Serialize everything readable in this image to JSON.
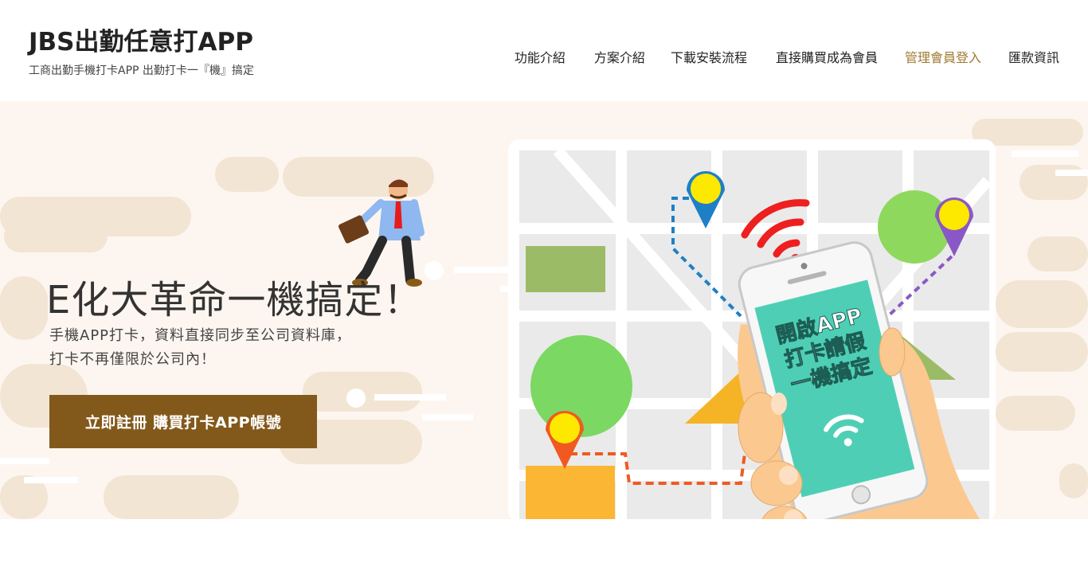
{
  "header": {
    "title": "JBS出勤任意打APP",
    "tagline": "工商出勤手機打卡APP  出勤打卡一『機』搞定"
  },
  "nav": {
    "items": [
      {
        "label": "功能介紹"
      },
      {
        "label": "方案介紹"
      },
      {
        "label": "下載安裝流程"
      },
      {
        "label": "直接購買成為會員"
      },
      {
        "label": "管理會員登入"
      },
      {
        "label": "匯款資訊"
      }
    ],
    "active_index": 4
  },
  "hero": {
    "title": "E化大革命一機搞定！",
    "subtitle_line1": "手機APP打卡，資料直接同步至公司資料庫，",
    "subtitle_line2": "打卡不再僅限於公司內！",
    "cta_label": "立即註冊 購買打卡APP帳號",
    "phone_line1": "開啟APP",
    "phone_line2": "打卡請假",
    "phone_line3": "一機搞定"
  },
  "colors": {
    "accent": "#83591b",
    "nav_active": "#a07a33",
    "hero_bg": "#fdf6f0",
    "phone_screen": "#4ecfb5"
  }
}
